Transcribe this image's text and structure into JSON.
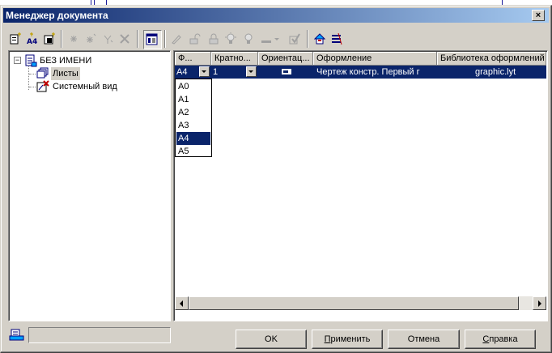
{
  "window": {
    "title": "Менеджер документа",
    "close_glyph": "×"
  },
  "toolbar": {
    "icons": [
      "new-sheet-icon",
      "new-sheet-a4-icon",
      "new-layer-icon",
      "insert-view-icon",
      "copy-view-icon",
      "move-view-icon",
      "delete-icon",
      "details-view-toggle-icon",
      "edit-icon",
      "unlock-icon",
      "lock-icon",
      "bulb-on-icon",
      "bulb-off-icon",
      "line-color-icon",
      "check-icon",
      "export-icon",
      "properties-icon"
    ]
  },
  "tree": {
    "root": {
      "label": "БЕЗ ИМЕНИ",
      "expander": "−",
      "icon": "document-icon"
    },
    "children": [
      {
        "label": "Листы",
        "icon": "sheets-icon",
        "selected": true
      },
      {
        "label": "Системный вид",
        "icon": "system-view-icon",
        "selected": false
      }
    ]
  },
  "grid": {
    "columns": [
      "Ф...",
      "Кратно...",
      "Ориентац...",
      "Оформление",
      "Библиотека оформлений"
    ],
    "rows": [
      {
        "format": "A4",
        "scale": "1",
        "orientation": "landscape-icon",
        "design": "Чертеж констр. Первый г",
        "library": "graphic.lyt",
        "selected": true
      }
    ]
  },
  "format_dropdown": {
    "options": [
      "A0",
      "A1",
      "A2",
      "A3",
      "A4",
      "A5"
    ],
    "selected_index": 4
  },
  "status": {
    "icon": "document-status-icon",
    "text": ""
  },
  "buttons": {
    "ok": "OK",
    "apply_prefix": "",
    "apply_underlined": "П",
    "apply_rest": "рименить",
    "cancel": "Отмена",
    "help_prefix": "",
    "help_underlined": "С",
    "help_rest": "правка"
  },
  "colors": {
    "face": "#d4d0c8",
    "title_start": "#0a246a",
    "title_end": "#a6caf0",
    "selection": "#0a246a"
  }
}
